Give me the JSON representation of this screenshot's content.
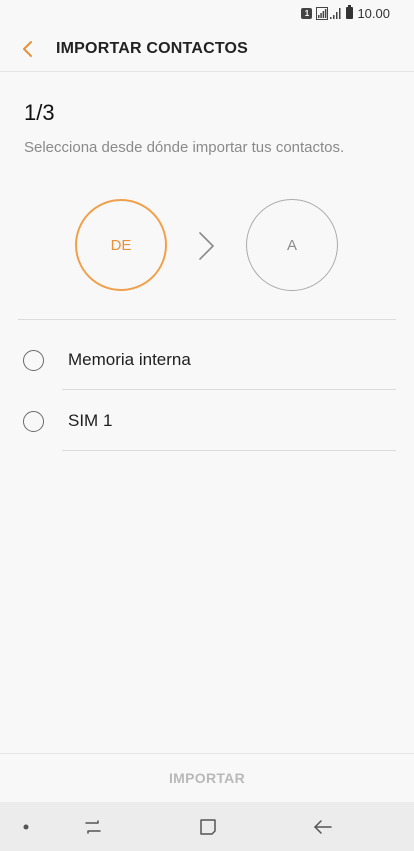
{
  "status_bar": {
    "sim_badge": "1",
    "time": "10.00"
  },
  "header": {
    "back_icon": "chevron-left-icon",
    "title": "IMPORTAR CONTACTOS",
    "accent_color": "#e8913a"
  },
  "wizard": {
    "step": "1/3",
    "instruction": "Selecciona desde dónde importar tus contactos.",
    "from_label": "DE",
    "to_label": "A",
    "arrow_icon": "chevron-right-icon"
  },
  "options": [
    {
      "label": "Memoria interna",
      "selected": false
    },
    {
      "label": "SIM 1",
      "selected": false
    }
  ],
  "footer": {
    "import_label": "IMPORTAR"
  },
  "navigation": {
    "items": [
      "dot-icon",
      "recents-icon",
      "home-icon",
      "back-arrow-icon"
    ]
  }
}
